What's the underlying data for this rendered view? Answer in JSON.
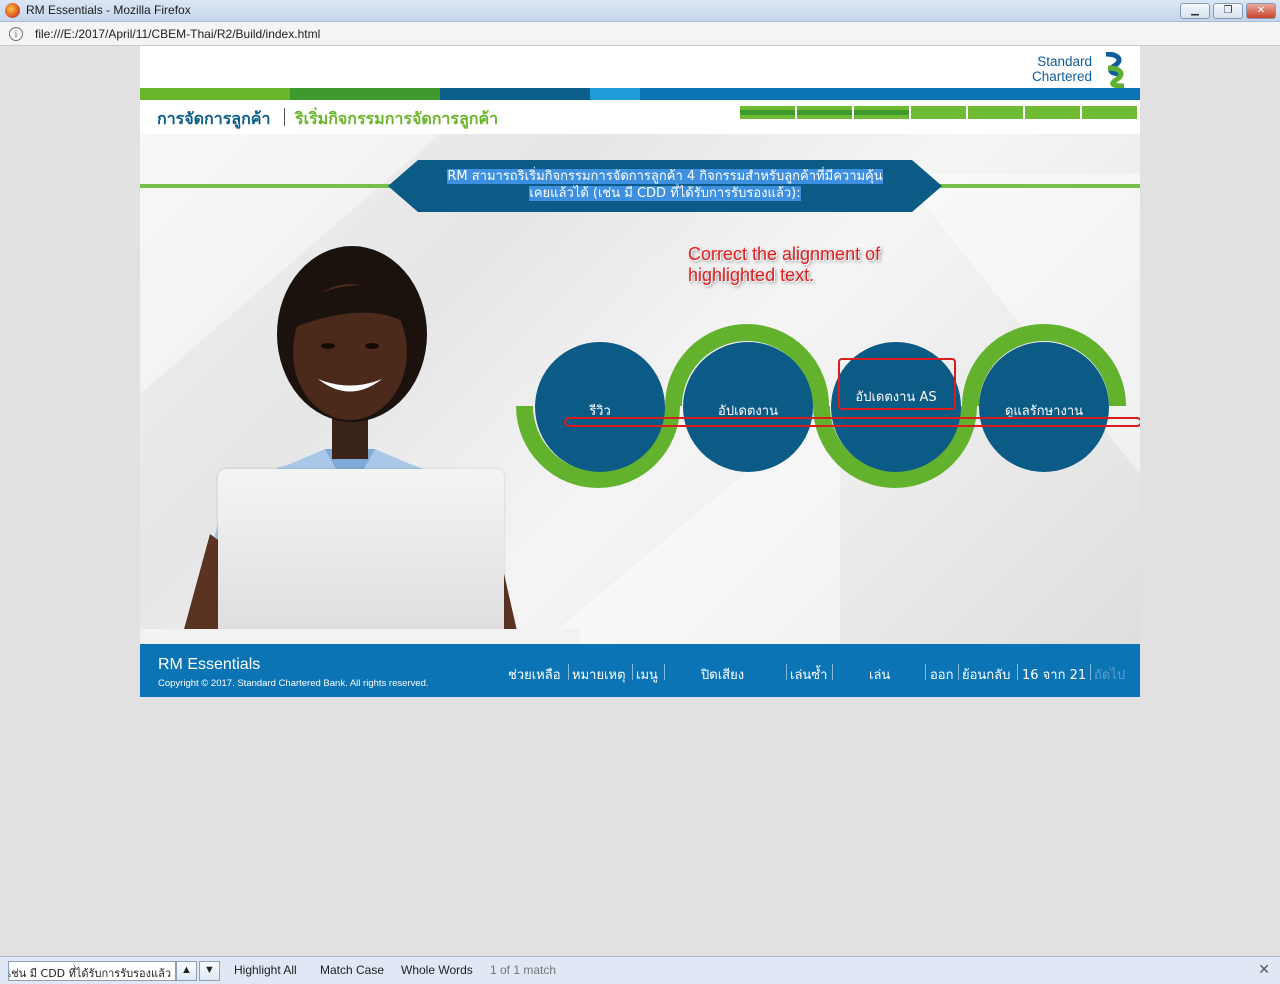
{
  "browser": {
    "window_title": "RM Essentials - Mozilla Firefox",
    "url": "file:///E:/2017/April/11/CBEM-Thai/R2/Build/index.html",
    "controls": {
      "minimize": "▁",
      "maximize": "❐",
      "close": "✕"
    }
  },
  "logo": {
    "line1": "Standard",
    "line2": "Chartered"
  },
  "colorbar": [
    "#6ab52a",
    "#3f9a2e",
    "#0b5f8a",
    "#1f9bd8",
    "#0b74b4"
  ],
  "header": {
    "crumb_main": "การจัดการลูกค้า",
    "crumb_sub": "ริเริ่มกิจกรรมการจัดการลูกค้า",
    "progress": {
      "total_segments": 7,
      "completed_segments": 3
    }
  },
  "banner": {
    "line1": "RM สามารถริเริ่มกิจกรรมการจัดการลูกค้า 4 กิจกรรมสำหรับลูกค้าที่มีความคุ้น",
    "line2": "เคยแล้วได้ (เช่น มี CDD ที่ได้รับการรับรองแล้ว):"
  },
  "annotation": {
    "line1": "Correct the alignment of",
    "line2": "highlighted text."
  },
  "activities": [
    {
      "label": "รีวิว"
    },
    {
      "label": "อัปเดตงาน"
    },
    {
      "label": "อัปเดตงาน AS"
    },
    {
      "label": "ดูแลรักษางาน"
    }
  ],
  "footer": {
    "brand": "RM Essentials",
    "copyright": "Copyright © 2017. Standard Chartered Bank. All rights reserved.",
    "nav": {
      "help": "ช่วยเหลือ",
      "notes": "หมายเหตุ",
      "menu": "เมนู",
      "mute": "ปิดเสียง",
      "replay": "เล่นซ้ำ",
      "play": "เล่น",
      "exit": "ออก",
      "back": "ย้อนกลับ",
      "page": "16 จาก 21",
      "next": "ถัดไป"
    }
  },
  "findbar": {
    "query": "เช่น มี CDD ที่ได้รับการรับรองแล้ว):",
    "up": "▲",
    "down": "▼",
    "highlight_all": "Highlight All",
    "match_case": "Match Case",
    "whole_words": "Whole Words",
    "match_status": "1 of 1 match",
    "close": "✕"
  }
}
